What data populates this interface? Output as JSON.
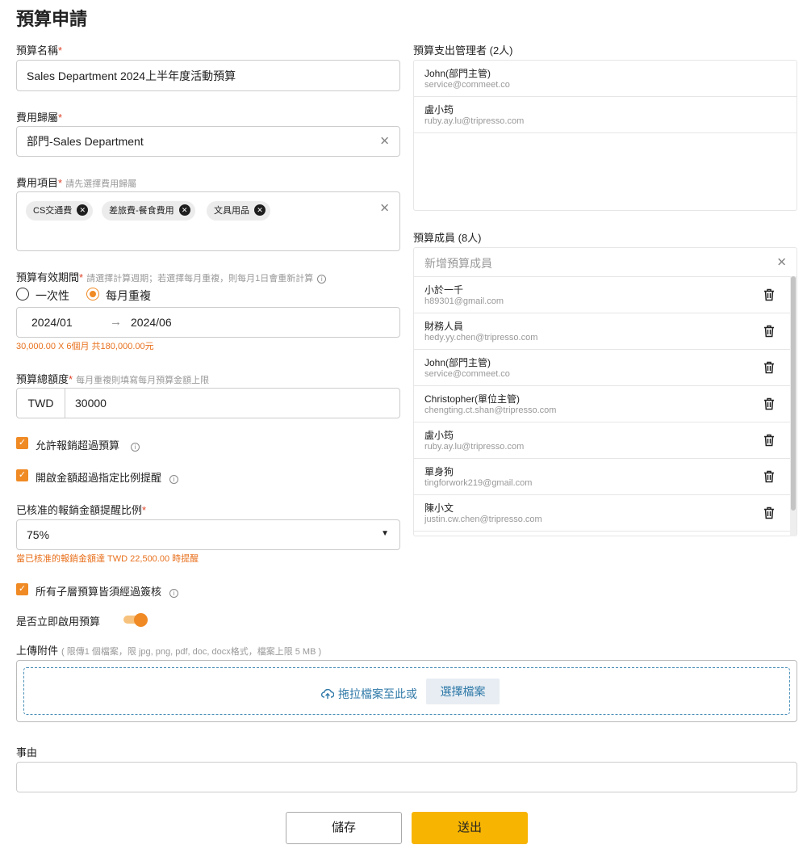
{
  "page": {
    "title": "預算申請"
  },
  "budget_name": {
    "label": "預算名稱",
    "value": "Sales Department 2024上半年度活動預算"
  },
  "expense_owner": {
    "label": "費用歸屬",
    "value": "部門-Sales Department"
  },
  "expense_items": {
    "label": "費用項目",
    "hint": "請先選擇費用歸屬",
    "tags": [
      "CS交通費",
      "差旅費-餐食費用",
      "文具用品"
    ]
  },
  "validity": {
    "label": "預算有效期間",
    "hint": "請選擇計算週期；若選擇每月重複，則每月1日會重新計算",
    "options": [
      "一次性",
      "每月重複"
    ],
    "selected": "每月重複",
    "start": "2024/01",
    "end": "2024/06",
    "summary": "30,000.00 X 6個月 共180,000.00元"
  },
  "amount": {
    "label": "預算總額度",
    "hint": "每月重複則填寫每月預算金額上限",
    "currency": "TWD",
    "value": "30000"
  },
  "checks": {
    "allow_over": {
      "label": "允許報銷超過預算",
      "checked": true
    },
    "ratio_alert": {
      "label": "開啟金額超過指定比例提醒",
      "checked": true
    },
    "sub_approval": {
      "label": "所有子層預算皆須經過簽核",
      "checked": true
    }
  },
  "ratio": {
    "label": "已核准的報銷金額提醒比例",
    "value": "75%",
    "note": "當已核准的報銷金額達 TWD 22,500.00 時提醒"
  },
  "enable": {
    "label": "是否立即啟用預算",
    "on": true
  },
  "attachment": {
    "label": "上傳附件",
    "hint": "( 限傳1 個檔案，限 jpg, png, pdf, doc, docx格式，檔案上限 5 MB )",
    "drop_text": "拖拉檔案至此或",
    "choose_label": "選擇檔案"
  },
  "reason": {
    "label": "事由",
    "value": ""
  },
  "actions": {
    "save": "儲存",
    "submit": "送出"
  },
  "managers": {
    "label": "預算支出管理者 (2人)",
    "items": [
      {
        "name": "John(部門主管)",
        "email": "service@commeet.co"
      },
      {
        "name": "盧小筠",
        "email": "ruby.ay.lu@tripresso.com"
      }
    ]
  },
  "members": {
    "label": "預算成員 (8人)",
    "add_placeholder": "新增預算成員",
    "items": [
      {
        "name": "小於一千",
        "email": "h89301@gmail.com"
      },
      {
        "name": "財務人員",
        "email": "hedy.yy.chen@tripresso.com"
      },
      {
        "name": "John(部門主管)",
        "email": "service@commeet.co"
      },
      {
        "name": "Christopher(單位主管)",
        "email": "chengting.ct.shan@tripresso.com"
      },
      {
        "name": "盧小筠",
        "email": "ruby.ay.lu@tripresso.com"
      },
      {
        "name": "單身狗",
        "email": "tingforwork219@gmail.com"
      },
      {
        "name": "陳小文",
        "email": "justin.cw.chen@tripresso.com"
      }
    ]
  },
  "icons": {
    "clear": "close-icon",
    "tag_remove": "close-circle-icon",
    "arrow": "arrow-right-icon",
    "dropdown": "caret-down-icon",
    "upload": "cloud-upload-icon",
    "trash": "trash-icon",
    "info": "info-icon",
    "check": "check-icon"
  },
  "colors": {
    "accent": "#f08a24",
    "primary_button": "#f7b400",
    "link": "#2f79a8",
    "warning_text": "#e8711e",
    "required": "#e0452b"
  }
}
